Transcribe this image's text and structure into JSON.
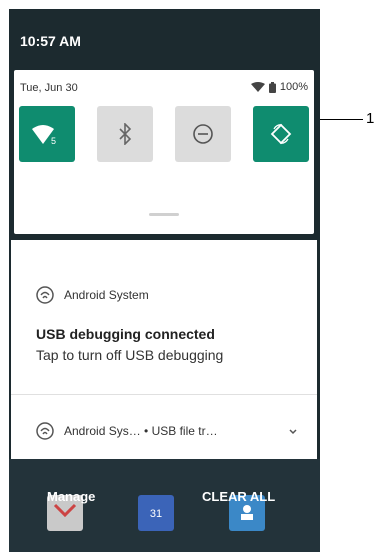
{
  "status": {
    "time": "10:57 AM"
  },
  "quick_settings": {
    "date": "Tue, Jun 30",
    "battery": "100%",
    "tiles": [
      {
        "name": "wifi",
        "state": "on",
        "badge": "5"
      },
      {
        "name": "bluetooth",
        "state": "off"
      },
      {
        "name": "do-not-disturb",
        "state": "off"
      },
      {
        "name": "auto-rotate",
        "state": "on"
      }
    ]
  },
  "notifications": [
    {
      "app": "Android System",
      "title": "USB debugging connected",
      "text": "Tap to turn off USB debugging"
    },
    {
      "app": "Android Sys… • USB file tr…"
    }
  ],
  "dock": {
    "manage_label": "Manage",
    "clear_all_label": "CLEAR ALL",
    "calendar_day": "31"
  },
  "callout": {
    "number": "1"
  },
  "colors": {
    "accent": "#0f8c6f",
    "tile_off": "#dcdcdc",
    "background": "#1c2a2f"
  }
}
